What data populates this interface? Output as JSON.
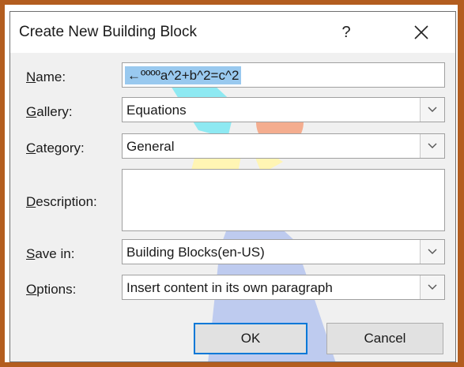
{
  "dialog": {
    "title": "Create New Building Block",
    "help_glyph": "?",
    "close_glyph": "close-icon"
  },
  "form": {
    "name": {
      "label_key": "N",
      "label_rest": "ame:",
      "value": "←ººººa^2+b^2=c^2"
    },
    "gallery": {
      "label_key": "G",
      "label_rest": "allery:",
      "value": "Equations"
    },
    "category": {
      "label_key": "C",
      "label_rest": "ategory:",
      "value": "General"
    },
    "description": {
      "label_key": "D",
      "label_rest": "escription:",
      "value": ""
    },
    "save_in": {
      "label_key": "S",
      "label_rest": "ave in:",
      "value": "Building Blocks(en-US)"
    },
    "options": {
      "label_key": "O",
      "label_rest": "ptions:",
      "value": "Insert content in its own paragraph"
    }
  },
  "buttons": {
    "ok": "OK",
    "cancel": "Cancel"
  },
  "colors": {
    "frame": "#b35d1f",
    "selection": "#99c9ef",
    "focus": "#0078d7"
  }
}
